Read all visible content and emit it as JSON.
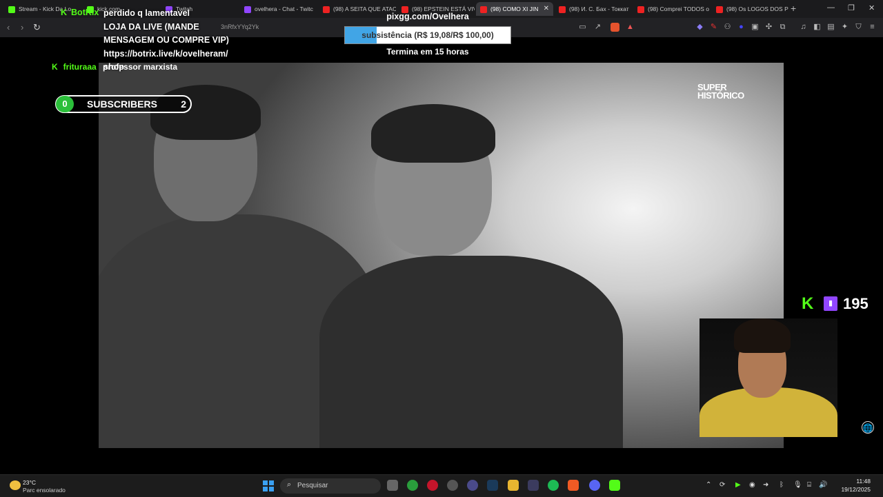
{
  "browser": {
    "tabs": [
      {
        "label": "Stream - Kick Da Lo"
      },
      {
        "label": "kick.com"
      },
      {
        "label": "Twitch"
      },
      {
        "label": "ovelhera - Chat - Twitc"
      },
      {
        "label": "(98) A SEITA QUE ATAC"
      },
      {
        "label": "(98) EPSTEIN ESTÁ VIV"
      },
      {
        "label": "(98) COMO XI JIN"
      },
      {
        "label": "(98) И. С. Бах - Токкат"
      },
      {
        "label": "(98) Comprei TODOS o"
      },
      {
        "label": "(98) Os LOGOS DOS P"
      }
    ],
    "url": "3nRfxYYq2Yk"
  },
  "video": {
    "watermark_line1": "SUPER",
    "watermark_line2": "HISTÓRICO"
  },
  "overlay": {
    "botrix_name": "BotRix",
    "chat_lines": [
      "perdido q lamentavel",
      "LOJA DA LIVE (MANDE",
      "MENSAGEM OU COMPRE VIP)",
      "https://botrix.live/k/ovelheram/",
      "shop"
    ],
    "chat_user": "frituraaa",
    "chat_message": "professor marxista",
    "subs": {
      "left_count": "0",
      "label": "SUBSCRIBERS",
      "right_count": "2"
    },
    "goal": {
      "title": "pixgg.com/Ovelhera",
      "text": "subsistência (R$ 19,08/R$ 100,00)",
      "progress_fraction": 0.19,
      "footer": "Termina em 15 horas"
    },
    "viewer_count": "195"
  },
  "taskbar": {
    "weather_temp": "23°C",
    "weather_condition": "Parc ensolarado",
    "search_placeholder": "Pesquisar",
    "time": "11:48",
    "date": "19/12/2025"
  },
  "colors": {
    "kick_green": "#53fc18",
    "twitch_purple": "#9146ff",
    "goal_fill": "#41a5e6"
  }
}
